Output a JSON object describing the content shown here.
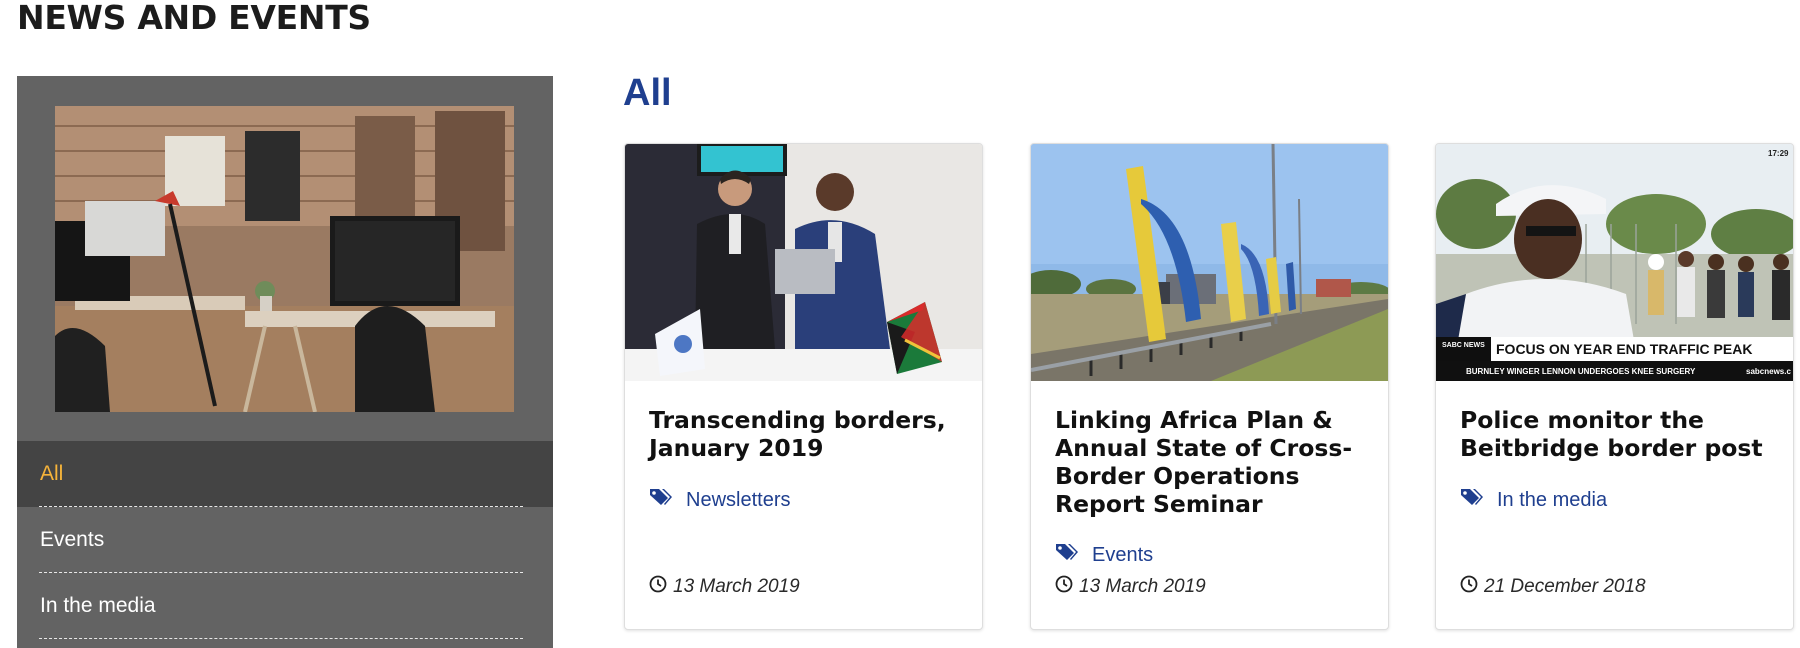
{
  "page": {
    "heading": "NEWS AND EVENTS",
    "section_title": "All"
  },
  "sidebar": {
    "image_alt": "office workspace",
    "nav": [
      {
        "label": "All",
        "active": true
      },
      {
        "label": "Events",
        "active": false
      },
      {
        "label": "In the media",
        "active": false
      }
    ]
  },
  "cards": [
    {
      "title": "Transcending borders, January 2019",
      "category": "Newsletters",
      "date": "13 March 2019",
      "category_icon": "tag-icon",
      "date_icon": "clock-icon"
    },
    {
      "title": "Linking Africa Plan & Annual State of Cross-Border Operations Report Seminar",
      "category": "Events",
      "date": "13 March 2019",
      "category_icon": "tag-icon",
      "date_icon": "clock-icon"
    },
    {
      "title": "Police monitor the Beitbridge border post",
      "category": "In the media",
      "date": "21 December 2018",
      "category_icon": "tag-icon",
      "date_icon": "clock-icon",
      "image_overlay": {
        "channel": "SABC NEWS",
        "headline": "FOCUS ON YEAR END TRAFFIC PEAK",
        "ticker": "BURNLEY  WINGER  LENNON  UNDERGOES  KNEE  SURGERY",
        "ticker_site": "sabcnews.c",
        "clock": "17:29"
      }
    }
  ],
  "colors": {
    "accent_blue": "#1f3f8f",
    "active_nav": "#f7b43a",
    "sidebar_bg": "#636363",
    "sidebar_active_bg": "#444444"
  }
}
